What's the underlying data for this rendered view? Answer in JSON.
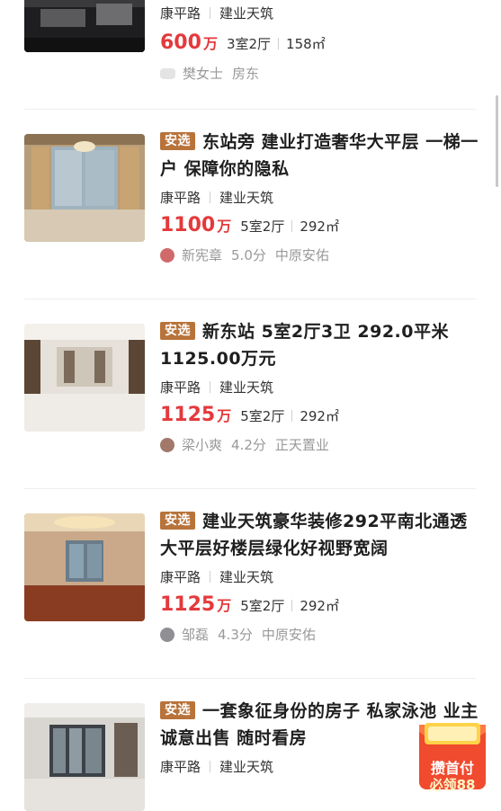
{
  "listings": [
    {
      "title": "",
      "tag": "",
      "location": {
        "road": "康平路",
        "community": "建业天筑"
      },
      "price": "600",
      "price_unit": "万",
      "layout": "3室2厅",
      "area": "158㎡",
      "agent": {
        "name": "樊女士",
        "rating": "",
        "company": "房东"
      }
    },
    {
      "title": "东站旁 建业打造奢华大平层 一梯一户 保障你的隐私",
      "tag": "安选",
      "location": {
        "road": "康平路",
        "community": "建业天筑"
      },
      "price": "1100",
      "price_unit": "万",
      "layout": "5室2厅",
      "area": "292㎡",
      "agent": {
        "name": "新宪章",
        "rating": "5.0分",
        "company": "中原安佑"
      }
    },
    {
      "title": "新东站 5室2厅3卫 292.0平米 1125.00万元",
      "tag": "安选",
      "location": {
        "road": "康平路",
        "community": "建业天筑"
      },
      "price": "1125",
      "price_unit": "万",
      "layout": "5室2厅",
      "area": "292㎡",
      "agent": {
        "name": "梁小爽",
        "rating": "4.2分",
        "company": "正天置业"
      }
    },
    {
      "title": "建业天筑豪华装修292平南北通透大平层好楼层绿化好视野宽阔",
      "tag": "安选",
      "location": {
        "road": "康平路",
        "community": "建业天筑"
      },
      "price": "1125",
      "price_unit": "万",
      "layout": "5室2厅",
      "area": "292㎡",
      "agent": {
        "name": "邹磊",
        "rating": "4.3分",
        "company": "中原安佑"
      }
    },
    {
      "title": "一套象征身份的房子 私家泳池 业主诚意出售 随时看房",
      "tag": "安选",
      "location": {
        "road": "康平路",
        "community": "建业天筑"
      },
      "price": "",
      "price_unit": "",
      "layout": "",
      "area": "",
      "agent": {
        "name": "",
        "rating": "",
        "company": ""
      }
    }
  ],
  "promo": {
    "line1": "攒首付",
    "line2": "必领88"
  },
  "colors": {
    "price": "#e4393c",
    "tag": "#b8733a",
    "divider": "#eeeeee"
  }
}
